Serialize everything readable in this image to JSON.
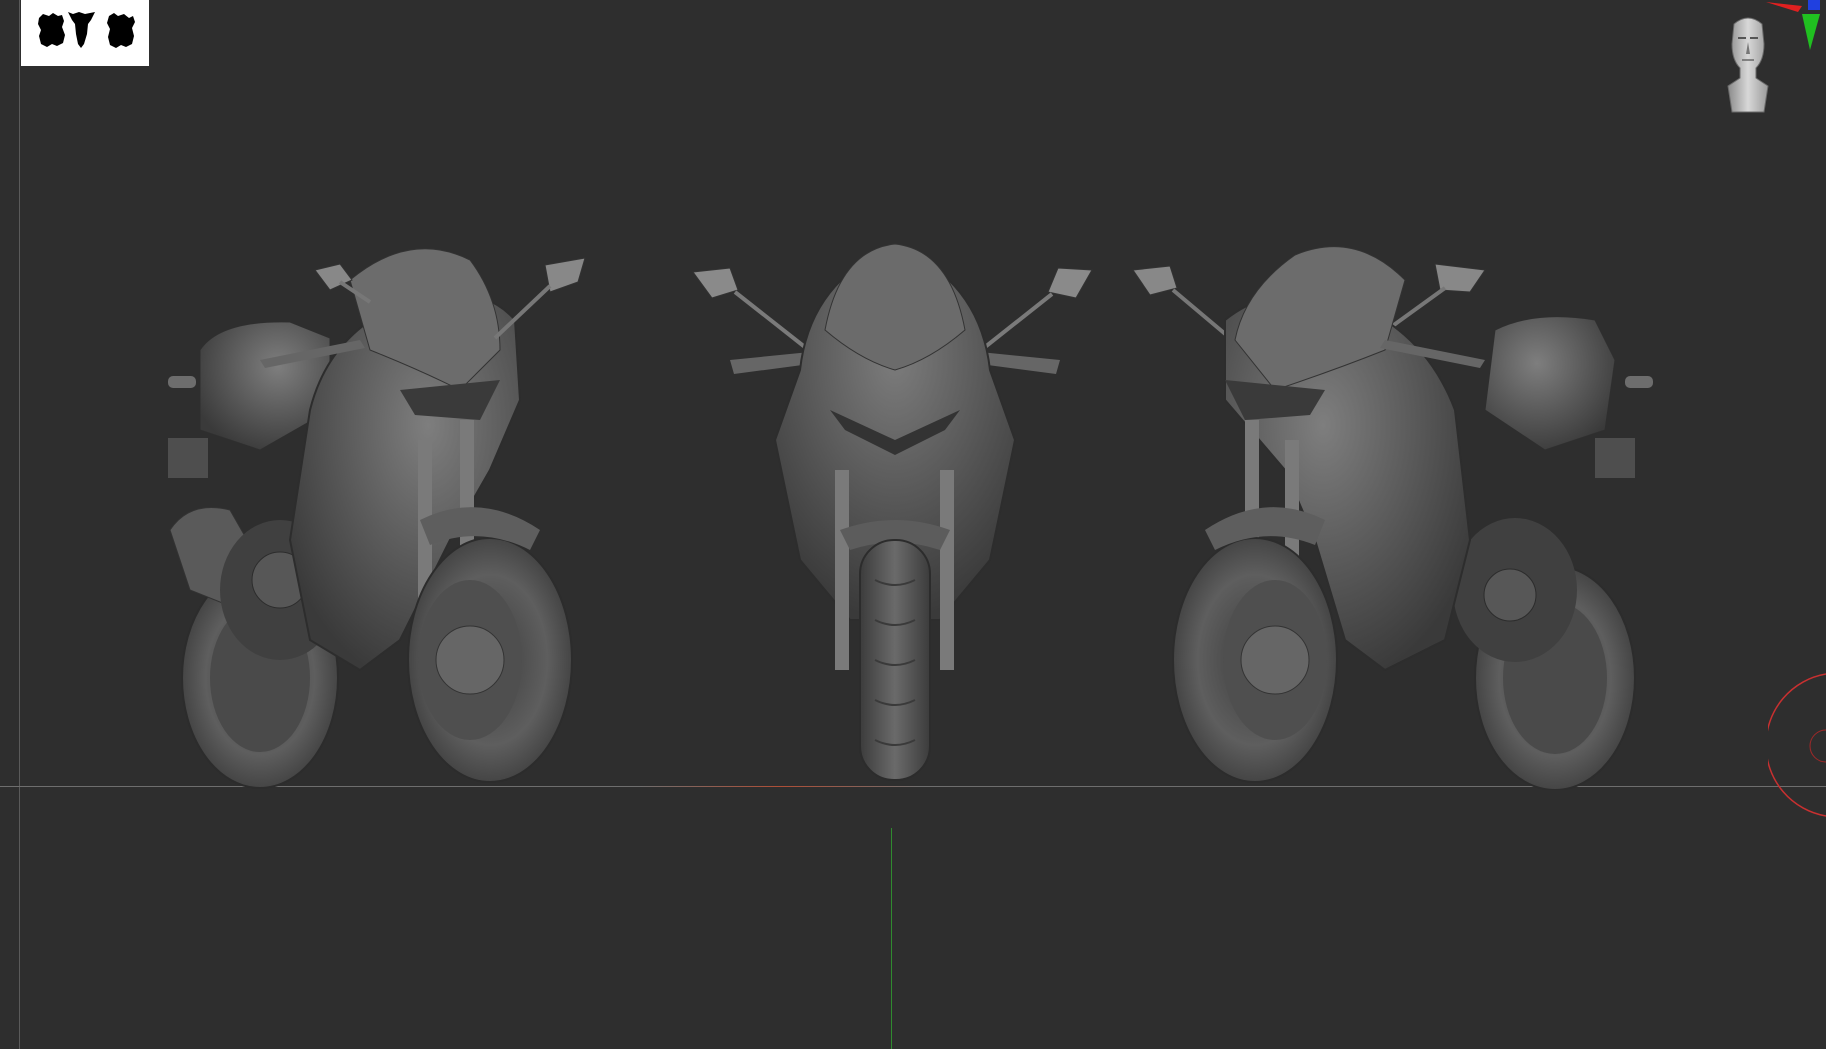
{
  "app": {
    "name": "",
    "viewport": {
      "background_color": "#2e2e2e",
      "grid_line_color": "#6e6e6e"
    }
  },
  "thumbnail": {
    "icon": "model-thumbnail-icon"
  },
  "gizmos": {
    "head": "head-orientation-icon",
    "axes": {
      "x_color": "#e02020",
      "y_color": "#20c020",
      "z_color": "#2040e0"
    },
    "rotate_ring_color": "#c83030"
  },
  "models": [
    {
      "view": "three-quarter-left",
      "icon": "motorcycle-icon"
    },
    {
      "view": "front",
      "icon": "motorcycle-icon"
    },
    {
      "view": "three-quarter-right",
      "icon": "motorcycle-icon"
    }
  ]
}
